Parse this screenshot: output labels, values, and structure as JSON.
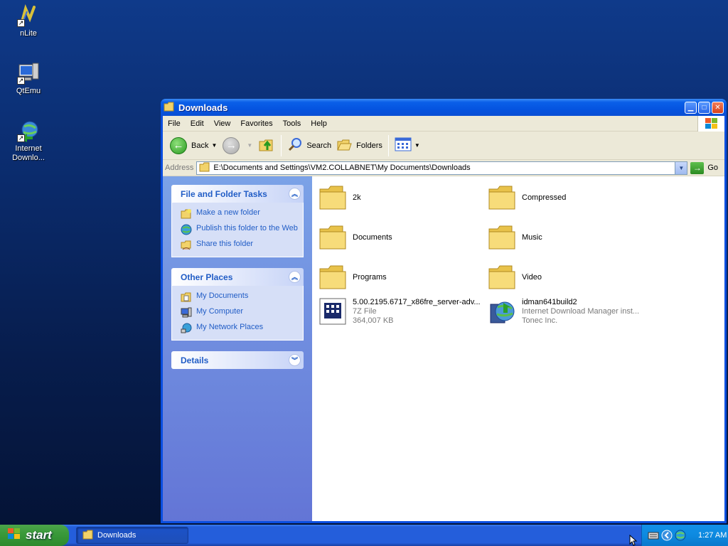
{
  "desktop": {
    "icons": [
      {
        "label": "nLite"
      },
      {
        "label": "QtEmu"
      },
      {
        "label": "Internet Downlo..."
      }
    ]
  },
  "window": {
    "title": "Downloads",
    "menu": [
      "File",
      "Edit",
      "View",
      "Favorites",
      "Tools",
      "Help"
    ],
    "toolbar": {
      "back": "Back",
      "search": "Search",
      "folders": "Folders"
    },
    "address": {
      "label": "Address",
      "path": "E:\\Documents and Settings\\VM2.COLLABNET\\My Documents\\Downloads",
      "go": "Go"
    },
    "taskpane": {
      "file_tasks": {
        "title": "File and Folder Tasks",
        "links": [
          "Make a new folder",
          "Publish this folder to the Web",
          "Share this folder"
        ]
      },
      "other_places": {
        "title": "Other Places",
        "links": [
          "My Documents",
          "My Computer",
          "My Network Places"
        ]
      },
      "details": {
        "title": "Details"
      }
    },
    "files": [
      {
        "name": "2k"
      },
      {
        "name": "Compressed"
      },
      {
        "name": "Documents"
      },
      {
        "name": "Music"
      },
      {
        "name": "Programs"
      },
      {
        "name": "Video"
      },
      {
        "name": "5.00.2195.6717_x86fre_server-adv...",
        "type": "7Z File",
        "size": "364,007 KB"
      },
      {
        "name": "idman641build2",
        "type": "Internet Download Manager inst...",
        "company": "Tonec Inc."
      }
    ]
  },
  "taskbar": {
    "start": "start",
    "task": "Downloads",
    "clock": "1:27 AM"
  },
  "colors": {
    "accent": "#0a4ee0",
    "link": "#215dc6",
    "start_green": "#3a9a3a"
  }
}
